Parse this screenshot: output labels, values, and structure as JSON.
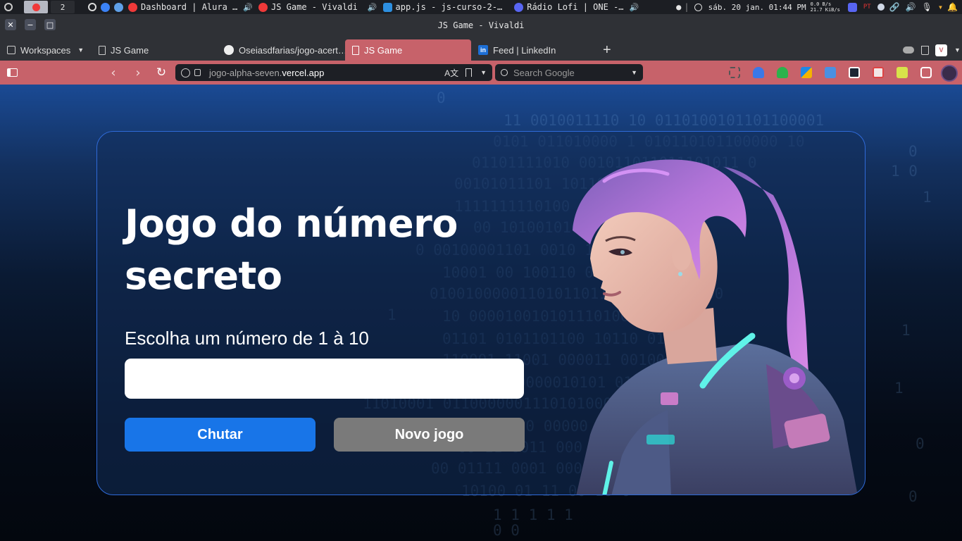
{
  "system_panel": {
    "workspace_number": "2",
    "tasks": [
      {
        "label": "Dashboard | Alura …",
        "icon": "vivaldi-icon",
        "color": "#ef3939"
      },
      {
        "label": "JS Game - Vivaldi",
        "icon": "vivaldi-icon",
        "color": "#ef3939"
      },
      {
        "label": "app.js - js-curso-2-…",
        "icon": "vscode-icon",
        "color": "#2d8fe0"
      },
      {
        "label": "Rádio Lofi | ONE -…",
        "icon": "discord-icon",
        "color": "#5865f2"
      }
    ],
    "clock": "sáb. 20 jan. 01:44 PM",
    "net_up": "0.0 B/s",
    "net_down": "21.7 KiB/s",
    "keyboard_layout": "PT"
  },
  "window": {
    "title": "JS Game - Vivaldi"
  },
  "tabs": {
    "workspaces_label": "Workspaces",
    "items": [
      {
        "label": "JS Game",
        "icon": "page-icon",
        "active": false
      },
      {
        "label": "Oseiasdfarias/jogo-acert…",
        "icon": "github-icon",
        "active": false
      },
      {
        "label": "JS Game",
        "icon": "page-icon",
        "active": true
      },
      {
        "label": "Feed | LinkedIn",
        "icon": "linkedin-icon",
        "active": false
      }
    ],
    "new_tab": "+"
  },
  "address": {
    "url_prefix": "jogo-alpha-seven.",
    "url_domain": "vercel.app",
    "search_placeholder": "Search Google"
  },
  "game": {
    "heading_line1": "Jogo do número",
    "heading_line2": "secreto",
    "prompt": "Escolha um número de 1 à 10",
    "input_value": "",
    "guess_button": "Chutar",
    "new_game_button": "Novo jogo"
  },
  "colors": {
    "accent_tab": "#c7626a",
    "primary_button": "#1875e8",
    "secondary_button": "#7a7a7a",
    "card_border": "#2f6ad8"
  }
}
